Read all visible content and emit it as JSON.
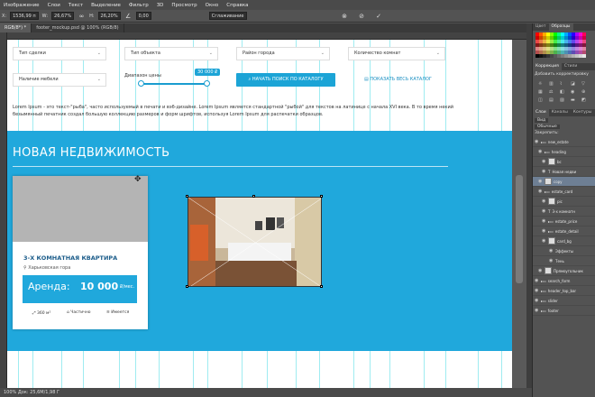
{
  "menubar": {
    "items": [
      "Изображение",
      "Слои",
      "Текст",
      "Выделение",
      "Фильтр",
      "3D",
      "Просмотр",
      "Окно",
      "Справка"
    ]
  },
  "options": {
    "x_label": "X:",
    "x_value": "1536,99 п",
    "w_label": "W:",
    "w_value": "26,67%",
    "h_label": "H:",
    "h_value": "26,20%",
    "angle_value": "0,00",
    "interp": "Сглаживание"
  },
  "tabs": [
    {
      "label": "RGB/8*) *"
    },
    {
      "label": "footer_mockup.psd @ 100% (RGB/8)"
    }
  ],
  "status": "100% Док: 25,6М/1,98 Г",
  "filters": {
    "deal_type": "Тип сделки",
    "object_type": "Тип объекта",
    "district": "Район города",
    "rooms": "Количество комнат",
    "furniture": "Наличие мебели",
    "price_range": "Диапазон цены",
    "price_value": "30 000 ₽",
    "search_button": "НАЧАТЬ ПОИСК ПО КАТАЛОГУ",
    "show_all": "ПОКАЗАТЬ ВЕСЬ КАТАЛОГ"
  },
  "lorem": "Lorem Ipsum - это текст-\"рыба\", часто используемый в печати и вэб-дизайне. Lorem Ipsum является стандартной \"рыбой\" для текстов на латинице с начала XVI века. В то время некий безымянный печатник создал большую коллекцию размеров и форм шрифтов, используя Lorem Ipsum для распечатки образцов.",
  "section": {
    "title": "НОВАЯ НЕДВИЖИМОСТЬ"
  },
  "card": {
    "title": "3-Х КОМНАТНАЯ КВАРТИРА",
    "address": "Харьковская гора",
    "rent_label": "Аренда:",
    "rent_value": "10 000",
    "rent_unit": "₽/мес.",
    "area": "360 м²",
    "feature2": "Частично",
    "feature3": "Имеется"
  },
  "panel": {
    "tabs": [
      "Цвет",
      "Образцы"
    ],
    "adj_tabs": [
      "Коррекция",
      "Стили"
    ],
    "adj_title": "Добавить корректировку",
    "layer_tabs": [
      "Слои",
      "Каналы",
      "Контуры"
    ],
    "kind": "Вид",
    "blend": "Обычные",
    "lock": "Закрепить:",
    "layers": [
      "new_estate",
      "heading",
      "bc",
      "Новая недви",
      "copy",
      "estate_card",
      "pic",
      "3-х комнатн",
      "estate_price",
      "estate_detail",
      "card_bg",
      "Эффекты",
      "Тень",
      "Прямоугольник",
      "search_form",
      "header_top_bar",
      "slider",
      "footer"
    ]
  },
  "colors": {
    "accent": "#20a8dc",
    "ps_bg": "#535353",
    "ps_dark": "#3e3e3e"
  }
}
